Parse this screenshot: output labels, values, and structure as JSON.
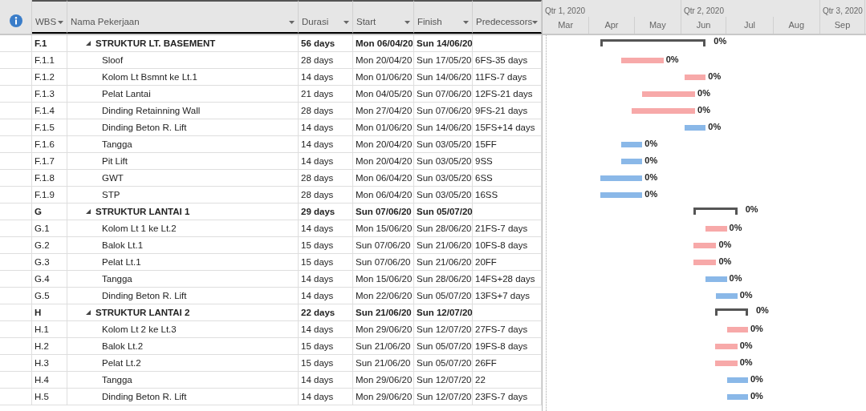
{
  "table": {
    "columns": [
      {
        "label": "WBS"
      },
      {
        "label": "Nama Pekerjaan"
      },
      {
        "label": "Durasi"
      },
      {
        "label": "Start"
      },
      {
        "label": "Finish"
      },
      {
        "label": "Predecessors"
      }
    ]
  },
  "timescale": {
    "quarters": [
      "Qtr 1, 2020",
      "Qtr 2, 2020",
      "Qtr 3, 2020"
    ],
    "months": [
      "Mar",
      "Apr",
      "May",
      "Jun",
      "Jul",
      "Aug",
      "Sep"
    ]
  },
  "tasks": [
    {
      "wbs": "F.1",
      "name": "STRUKTUR LT. BASEMENT",
      "duration": "56 days",
      "start": "Mon 06/04/20",
      "finish": "Sun 14/06/20",
      "kind": "summary",
      "expanded": true,
      "progress": "0%",
      "children": [
        {
          "wbs": "F.1.1",
          "name": "Sloof",
          "duration": "28 days",
          "start": "Mon 20/04/20",
          "finish": "Sun 17/05/20",
          "predecessors": "6FS-35 days",
          "kind": "critical",
          "progress": "0%"
        },
        {
          "wbs": "F.1.2",
          "name": "Kolom Lt Bsmnt ke Lt.1",
          "duration": "14 days",
          "start": "Mon 01/06/20",
          "finish": "Sun 14/06/20",
          "predecessors": "11FS-7 days",
          "kind": "critical",
          "progress": "0%"
        },
        {
          "wbs": "F.1.3",
          "name": "Pelat Lantai",
          "duration": "21 days",
          "start": "Mon 04/05/20",
          "finish": "Sun 07/06/20",
          "predecessors": "12FS-21 days",
          "kind": "critical",
          "progress": "0%"
        },
        {
          "wbs": "F.1.4",
          "name": "Dinding Retainning Wall",
          "duration": "28 days",
          "start": "Mon 27/04/20",
          "finish": "Sun 07/06/20",
          "predecessors": "9FS-21 days",
          "kind": "critical",
          "progress": "0%"
        },
        {
          "wbs": "F.1.5",
          "name": "Dinding Beton R. Lift",
          "duration": "14 days",
          "start": "Mon 01/06/20",
          "finish": "Sun 14/06/20",
          "predecessors": "15FS+14 days",
          "kind": "normal",
          "progress": "0%"
        },
        {
          "wbs": "F.1.6",
          "name": "Tangga",
          "duration": "14 days",
          "start": "Mon 20/04/20",
          "finish": "Sun 03/05/20",
          "predecessors": "15FF",
          "kind": "normal",
          "progress": "0%"
        },
        {
          "wbs": "F.1.7",
          "name": "Pit Lift",
          "duration": "14 days",
          "start": "Mon 20/04/20",
          "finish": "Sun 03/05/20",
          "predecessors": "9SS",
          "kind": "normal",
          "progress": "0%"
        },
        {
          "wbs": "F.1.8",
          "name": "GWT",
          "duration": "28 days",
          "start": "Mon 06/04/20",
          "finish": "Sun 03/05/20",
          "predecessors": "6SS",
          "kind": "normal",
          "progress": "0%"
        },
        {
          "wbs": "F.1.9",
          "name": "STP",
          "duration": "28 days",
          "start": "Mon 06/04/20",
          "finish": "Sun 03/05/20",
          "predecessors": "16SS",
          "kind": "normal",
          "progress": "0%"
        }
      ]
    },
    {
      "wbs": "G",
      "name": "STRUKTUR LANTAI 1",
      "duration": "29 days",
      "start": "Sun 07/06/20",
      "finish": "Sun 05/07/20",
      "kind": "summary",
      "expanded": true,
      "progress": "0%",
      "children": [
        {
          "wbs": "G.1",
          "name": "Kolom Lt 1 ke Lt.2",
          "duration": "14 days",
          "start": "Mon 15/06/20",
          "finish": "Sun 28/06/20",
          "predecessors": "21FS-7 days",
          "kind": "critical",
          "progress": "0%"
        },
        {
          "wbs": "G.2",
          "name": "Balok Lt.1",
          "duration": "15 days",
          "start": "Sun 07/06/20",
          "finish": "Sun 21/06/20",
          "predecessors": "10FS-8 days",
          "kind": "critical",
          "progress": "0%"
        },
        {
          "wbs": "G.3",
          "name": "Pelat Lt.1",
          "duration": "15 days",
          "start": "Sun 07/06/20",
          "finish": "Sun 21/06/20",
          "predecessors": "20FF",
          "kind": "critical",
          "progress": "0%"
        },
        {
          "wbs": "G.4",
          "name": "Tangga",
          "duration": "14 days",
          "start": "Mon 15/06/20",
          "finish": "Sun 28/06/20",
          "predecessors": "14FS+28 days",
          "kind": "normal",
          "progress": "0%"
        },
        {
          "wbs": "G.5",
          "name": "Dinding Beton R. Lift",
          "duration": "14 days",
          "start": "Mon 22/06/20",
          "finish": "Sun 05/07/20",
          "predecessors": "13FS+7 days",
          "kind": "normal",
          "progress": "0%"
        }
      ]
    },
    {
      "wbs": "H",
      "name": "STRUKTUR LANTAI 2",
      "duration": "22 days",
      "start": "Sun 21/06/20",
      "finish": "Sun 12/07/20",
      "kind": "summary",
      "expanded": true,
      "progress": "0%",
      "children": [
        {
          "wbs": "H.1",
          "name": "Kolom Lt 2 ke Lt.3",
          "duration": "14 days",
          "start": "Mon 29/06/20",
          "finish": "Sun 12/07/20",
          "predecessors": "27FS-7 days",
          "kind": "critical",
          "progress": "0%"
        },
        {
          "wbs": "H.2",
          "name": "Balok Lt.2",
          "duration": "15 days",
          "start": "Sun 21/06/20",
          "finish": "Sun 05/07/20",
          "predecessors": "19FS-8 days",
          "kind": "critical",
          "progress": "0%"
        },
        {
          "wbs": "H.3",
          "name": "Pelat Lt.2",
          "duration": "15 days",
          "start": "Sun 21/06/20",
          "finish": "Sun 05/07/20",
          "predecessors": "26FF",
          "kind": "critical",
          "progress": "0%"
        },
        {
          "wbs": "H.4",
          "name": "Tangga",
          "duration": "14 days",
          "start": "Mon 29/06/20",
          "finish": "Sun 12/07/20",
          "predecessors": "22",
          "kind": "normal",
          "progress": "0%"
        },
        {
          "wbs": "H.5",
          "name": "Dinding Beton R. Lift",
          "duration": "14 days",
          "start": "Mon 29/06/20",
          "finish": "Sun 12/07/20",
          "predecessors": "23FS-7 days",
          "kind": "normal",
          "progress": "0%"
        }
      ]
    }
  ]
}
